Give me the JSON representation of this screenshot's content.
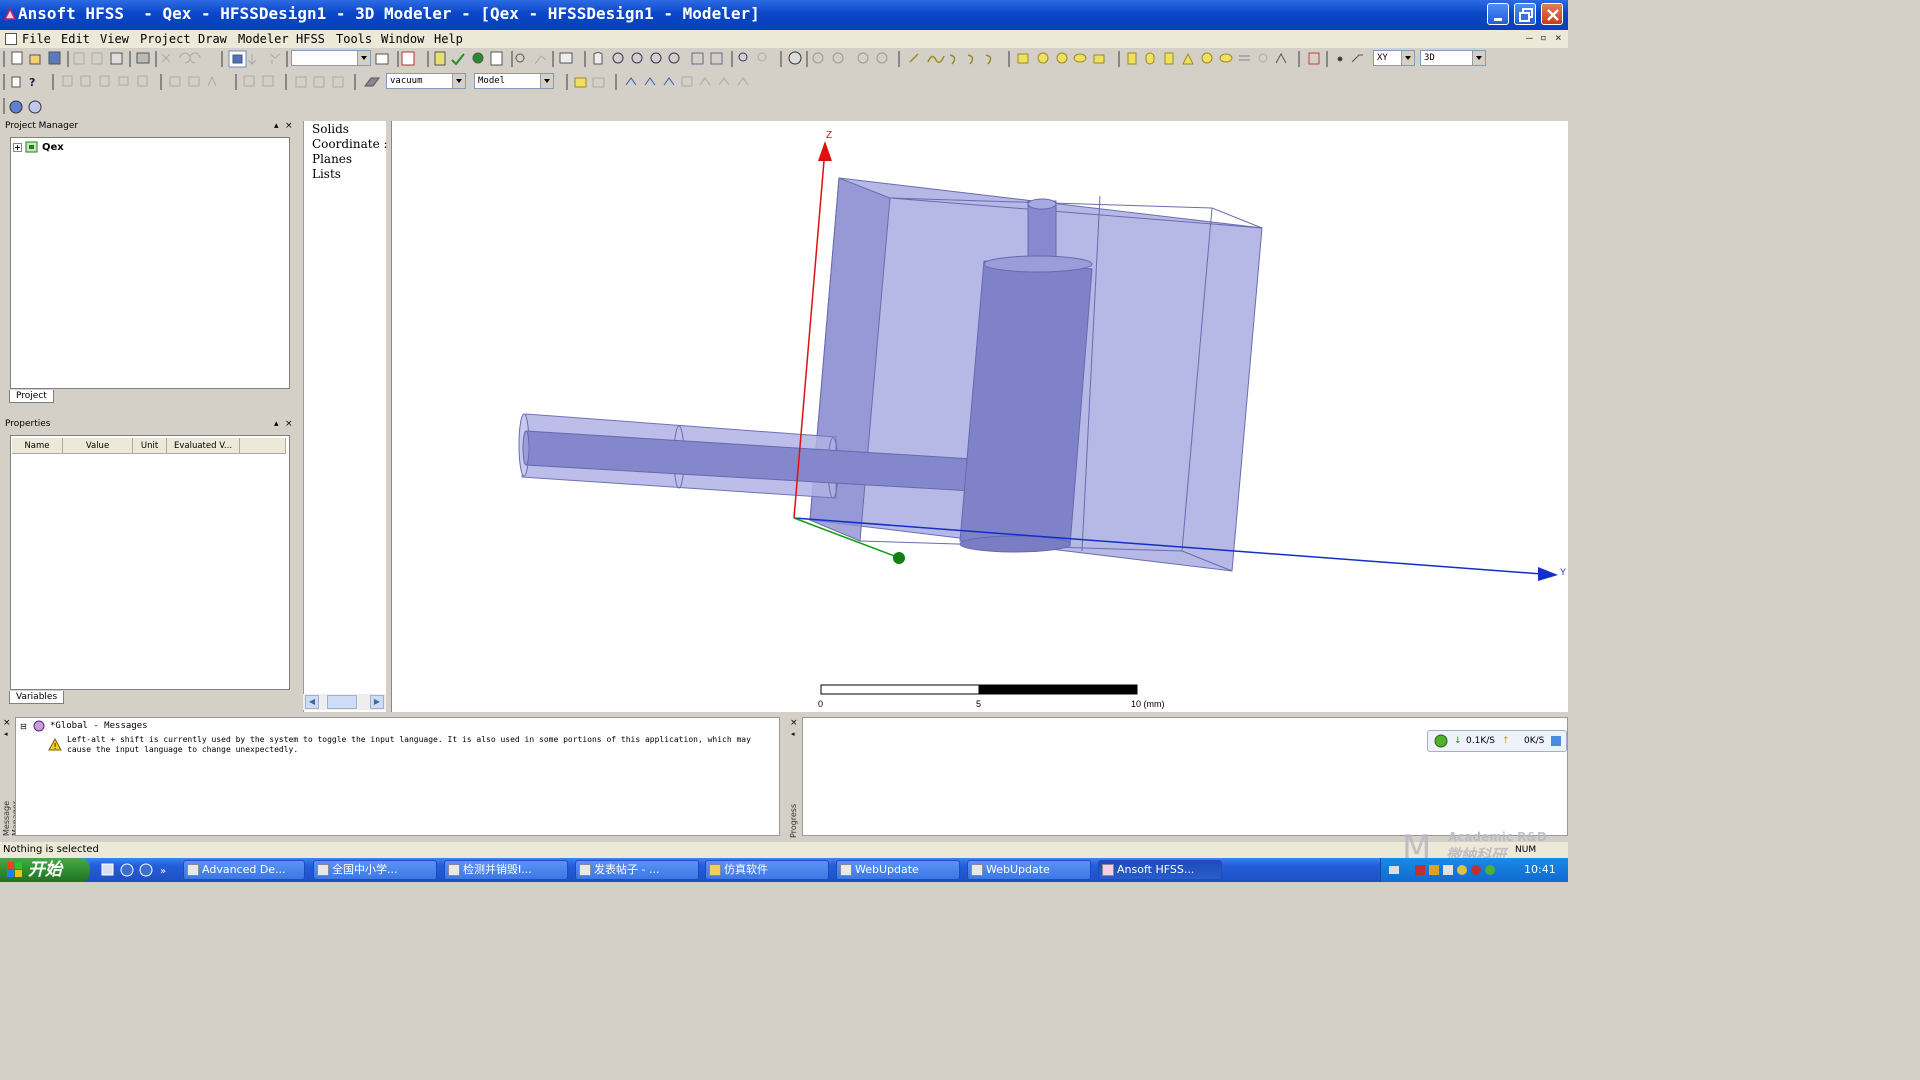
{
  "window": {
    "title": "Ansoft HFSS  - Qex - HFSSDesign1 - 3D Modeler - [Qex - HFSSDesign1 - Modeler]"
  },
  "menu": {
    "items": [
      "File",
      "Edit",
      "View",
      "Project",
      "Draw",
      "Modeler",
      "HFSS",
      "Tools",
      "Window",
      "Help"
    ]
  },
  "toolbar": {
    "material_combo": "vacuum",
    "model_combo": "Model",
    "plane_combo": "XY",
    "view_combo": "3D"
  },
  "project_manager": {
    "title": "Project Manager",
    "tree_root": "Qex",
    "tab": "Project"
  },
  "properties": {
    "title": "Properties",
    "columns": [
      "Name",
      "Value",
      "Unit",
      "Evaluated V..."
    ],
    "tab": "Variables"
  },
  "model_tree": {
    "items": [
      "Solids",
      "Coordinate :",
      "Planes",
      "Lists"
    ]
  },
  "viewport": {
    "axis_z": "Z",
    "axis_y": "Y",
    "scale_labels": [
      "0",
      "5",
      "10 (mm)"
    ],
    "colors": {
      "solid_fill": "#8d8fd0",
      "box_fill": "#b4b6e6",
      "z_axis": "#e01010",
      "y_axis": "#1030c8",
      "x_axis": "#10a010"
    }
  },
  "messages": {
    "side_label": "Message Manager",
    "group": "*Global - Messages",
    "warning": "Left-alt + shift is currently used by the system to toggle the input language. It is also used in some portions of this application, which may",
    "warning_line2": "cause the input language to change unexpectedly."
  },
  "progress": {
    "side_label": "Progress",
    "down_rate": "0.1K/S",
    "up_rate": "0K/S"
  },
  "status": {
    "text": "Nothing is selected",
    "num": "NUM"
  },
  "taskbar": {
    "start": "开始",
    "tasks": [
      "Advanced De...",
      "全国中小学...",
      "检测并销毁I...",
      "发表帖子 - ...",
      "仿真软件",
      "WebUpdate",
      "WebUpdate",
      "Ansoft HFSS..."
    ],
    "clock": "10:41"
  },
  "watermark": {
    "line1": "Academic R&D",
    "line2": "微納科研"
  }
}
